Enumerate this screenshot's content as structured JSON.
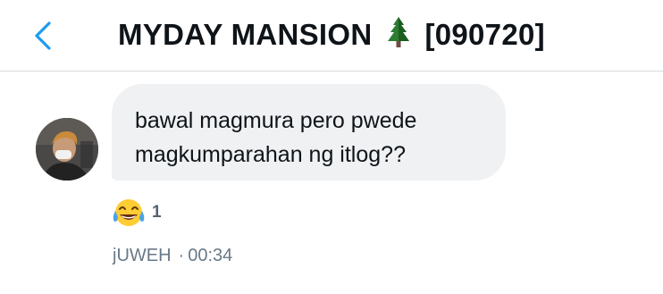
{
  "header": {
    "title": "MYDAY MANSION",
    "title_suffix": "[090720]",
    "tree_icon": "evergreen-tree-icon",
    "back_icon": "chevron-left-icon",
    "accent_color": "#1d9bf0"
  },
  "message": {
    "text_line1": "bawal magmura pero pwede",
    "text_line2": "magkumparahan ng itlog??",
    "bubble_color": "#eff1f3",
    "reaction": {
      "icon": "tears-of-joy-emoji-icon",
      "count": "1"
    },
    "sender": "jUWEH",
    "separator": "·",
    "time": "00:34"
  }
}
